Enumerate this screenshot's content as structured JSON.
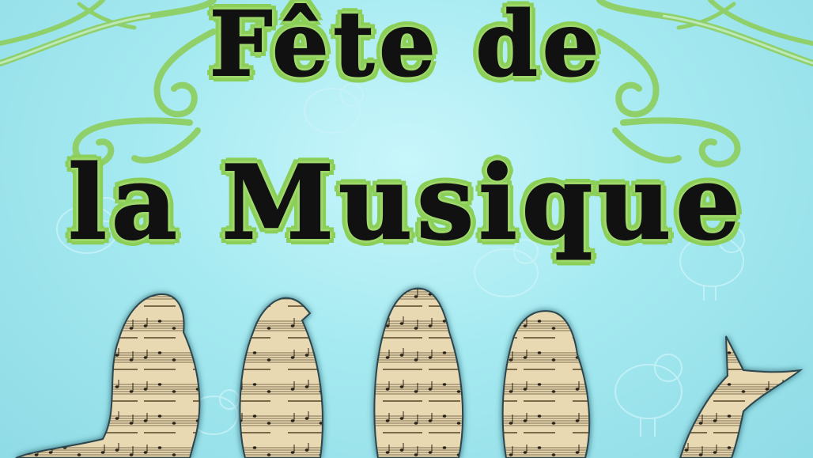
{
  "poster": {
    "title_line_1": "Fête de",
    "title_line_2": "la Musique",
    "colors": {
      "background": "#9fe6ee",
      "swirl_green": "#8fd06a",
      "title_fill": "#111111",
      "title_outline": "#9ed86a",
      "sheet_music_paper": "#e8d7b0",
      "bird_outline_dark": "#2a5560"
    },
    "decorations": {
      "left_swirl": "green-swirl-ornament",
      "right_swirl": "green-swirl-ornament",
      "background_birds": "faint-bird-outlines",
      "foreground_birds": "sheet-music-bird-silhouettes",
      "bird_count": 5
    }
  }
}
